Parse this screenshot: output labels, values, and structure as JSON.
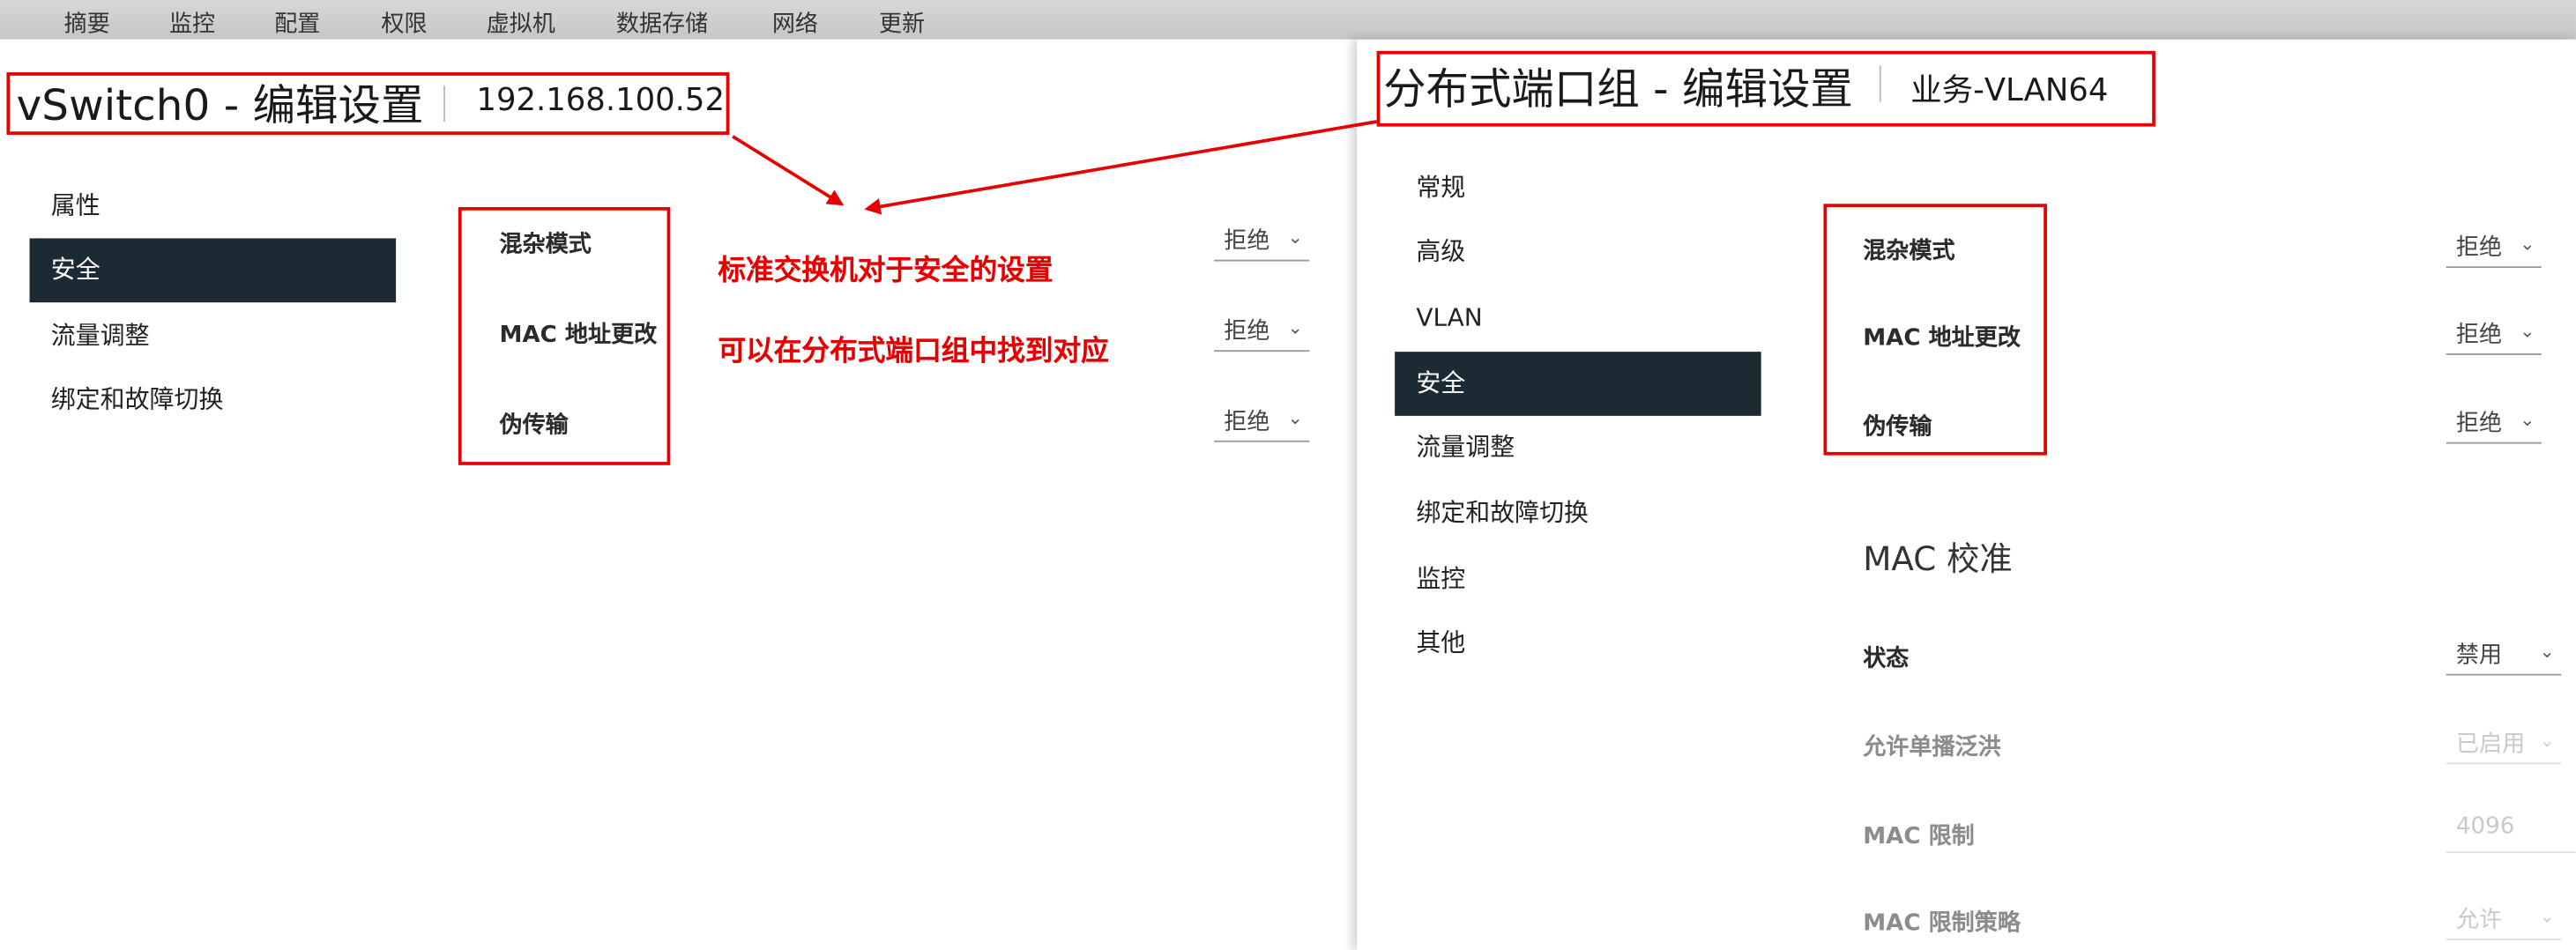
{
  "topnav": {
    "tabs": [
      "摘要",
      "监控",
      "配置",
      "权限",
      "虚拟机",
      "数据存储",
      "网络",
      "更新"
    ]
  },
  "left": {
    "title": "vSwitch0 - 编辑设置",
    "host": "192.168.100.52",
    "nav": [
      "属性",
      "安全",
      "流量调整",
      "绑定和故障切换"
    ],
    "active_nav": "安全",
    "fields": [
      {
        "label": "混杂模式",
        "value": "拒绝"
      },
      {
        "label": "MAC 地址更改",
        "value": "拒绝"
      },
      {
        "label": "伪传输",
        "value": "拒绝"
      }
    ]
  },
  "annotations": {
    "line1": "标准交换机对于安全的设置",
    "line2": "可以在分布式端口组中找到对应",
    "color": "#e60000"
  },
  "right": {
    "title": "分布式端口组 - 编辑设置",
    "portgroup": "业务-VLAN64",
    "nav": [
      "常规",
      "高级",
      "VLAN",
      "安全",
      "流量调整",
      "绑定和故障切换",
      "监控",
      "其他"
    ],
    "active_nav": "安全",
    "fields": [
      {
        "label": "混杂模式",
        "value": "拒绝"
      },
      {
        "label": "MAC 地址更改",
        "value": "拒绝"
      },
      {
        "label": "伪传输",
        "value": "拒绝"
      }
    ],
    "mac_section": {
      "title": "MAC 校准",
      "status_label": "状态",
      "status_value": "禁用",
      "unicast_label": "允许单播泛洪",
      "unicast_value": "已启用",
      "limit_label": "MAC 限制",
      "limit_value": "4096",
      "policy_label": "MAC 限制策略",
      "policy_value": "允许"
    }
  },
  "colors": {
    "active_nav_bg": "#1b2a33",
    "highlight_red": "#e60000"
  }
}
